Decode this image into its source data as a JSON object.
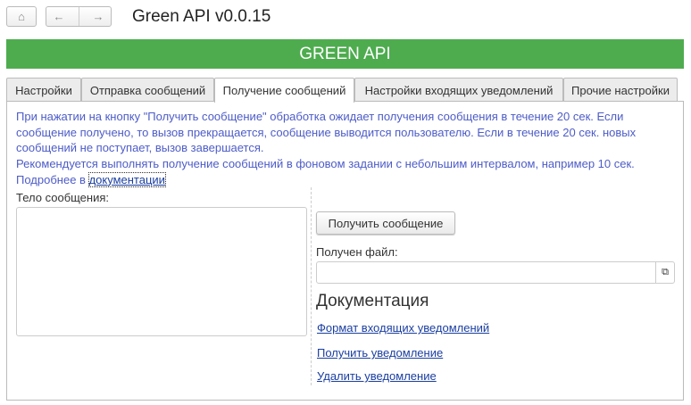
{
  "window": {
    "title": "Green API v0.0.15"
  },
  "banner": "GREEN API",
  "tabs": [
    {
      "label": "Настройки"
    },
    {
      "label": "Отправка сообщений"
    },
    {
      "label": "Получение сообщений",
      "active": true
    },
    {
      "label": "Настройки входящих уведомлений"
    },
    {
      "label": "Прочие настройки"
    }
  ],
  "info": {
    "line1": "При нажатии на кнопку \"Получить сообщение\" обработка ожидает  получения сообщения в течение 20 сек. Если сообщение получено, то вызов прекращается, сообщение выводится пользователю. Если в течение 20 сек. новых сообщений не поступает, вызов завершается.",
    "line2": "Рекомендуется выполнять получение сообщений в фоновом задании с небольшим интервалом, например 10 сек.",
    "more_prefix": "Подробнее в ",
    "more_link": "документации"
  },
  "body_label": "Тело  сообщения:",
  "body_value": "",
  "get_button": "Получить сообщение",
  "file_label": "Получен файл:",
  "file_value": "",
  "docs": {
    "heading": "Документация",
    "links": [
      "Формат входящих уведомлений",
      "Получить уведомление",
      "Удалить уведомление"
    ]
  }
}
